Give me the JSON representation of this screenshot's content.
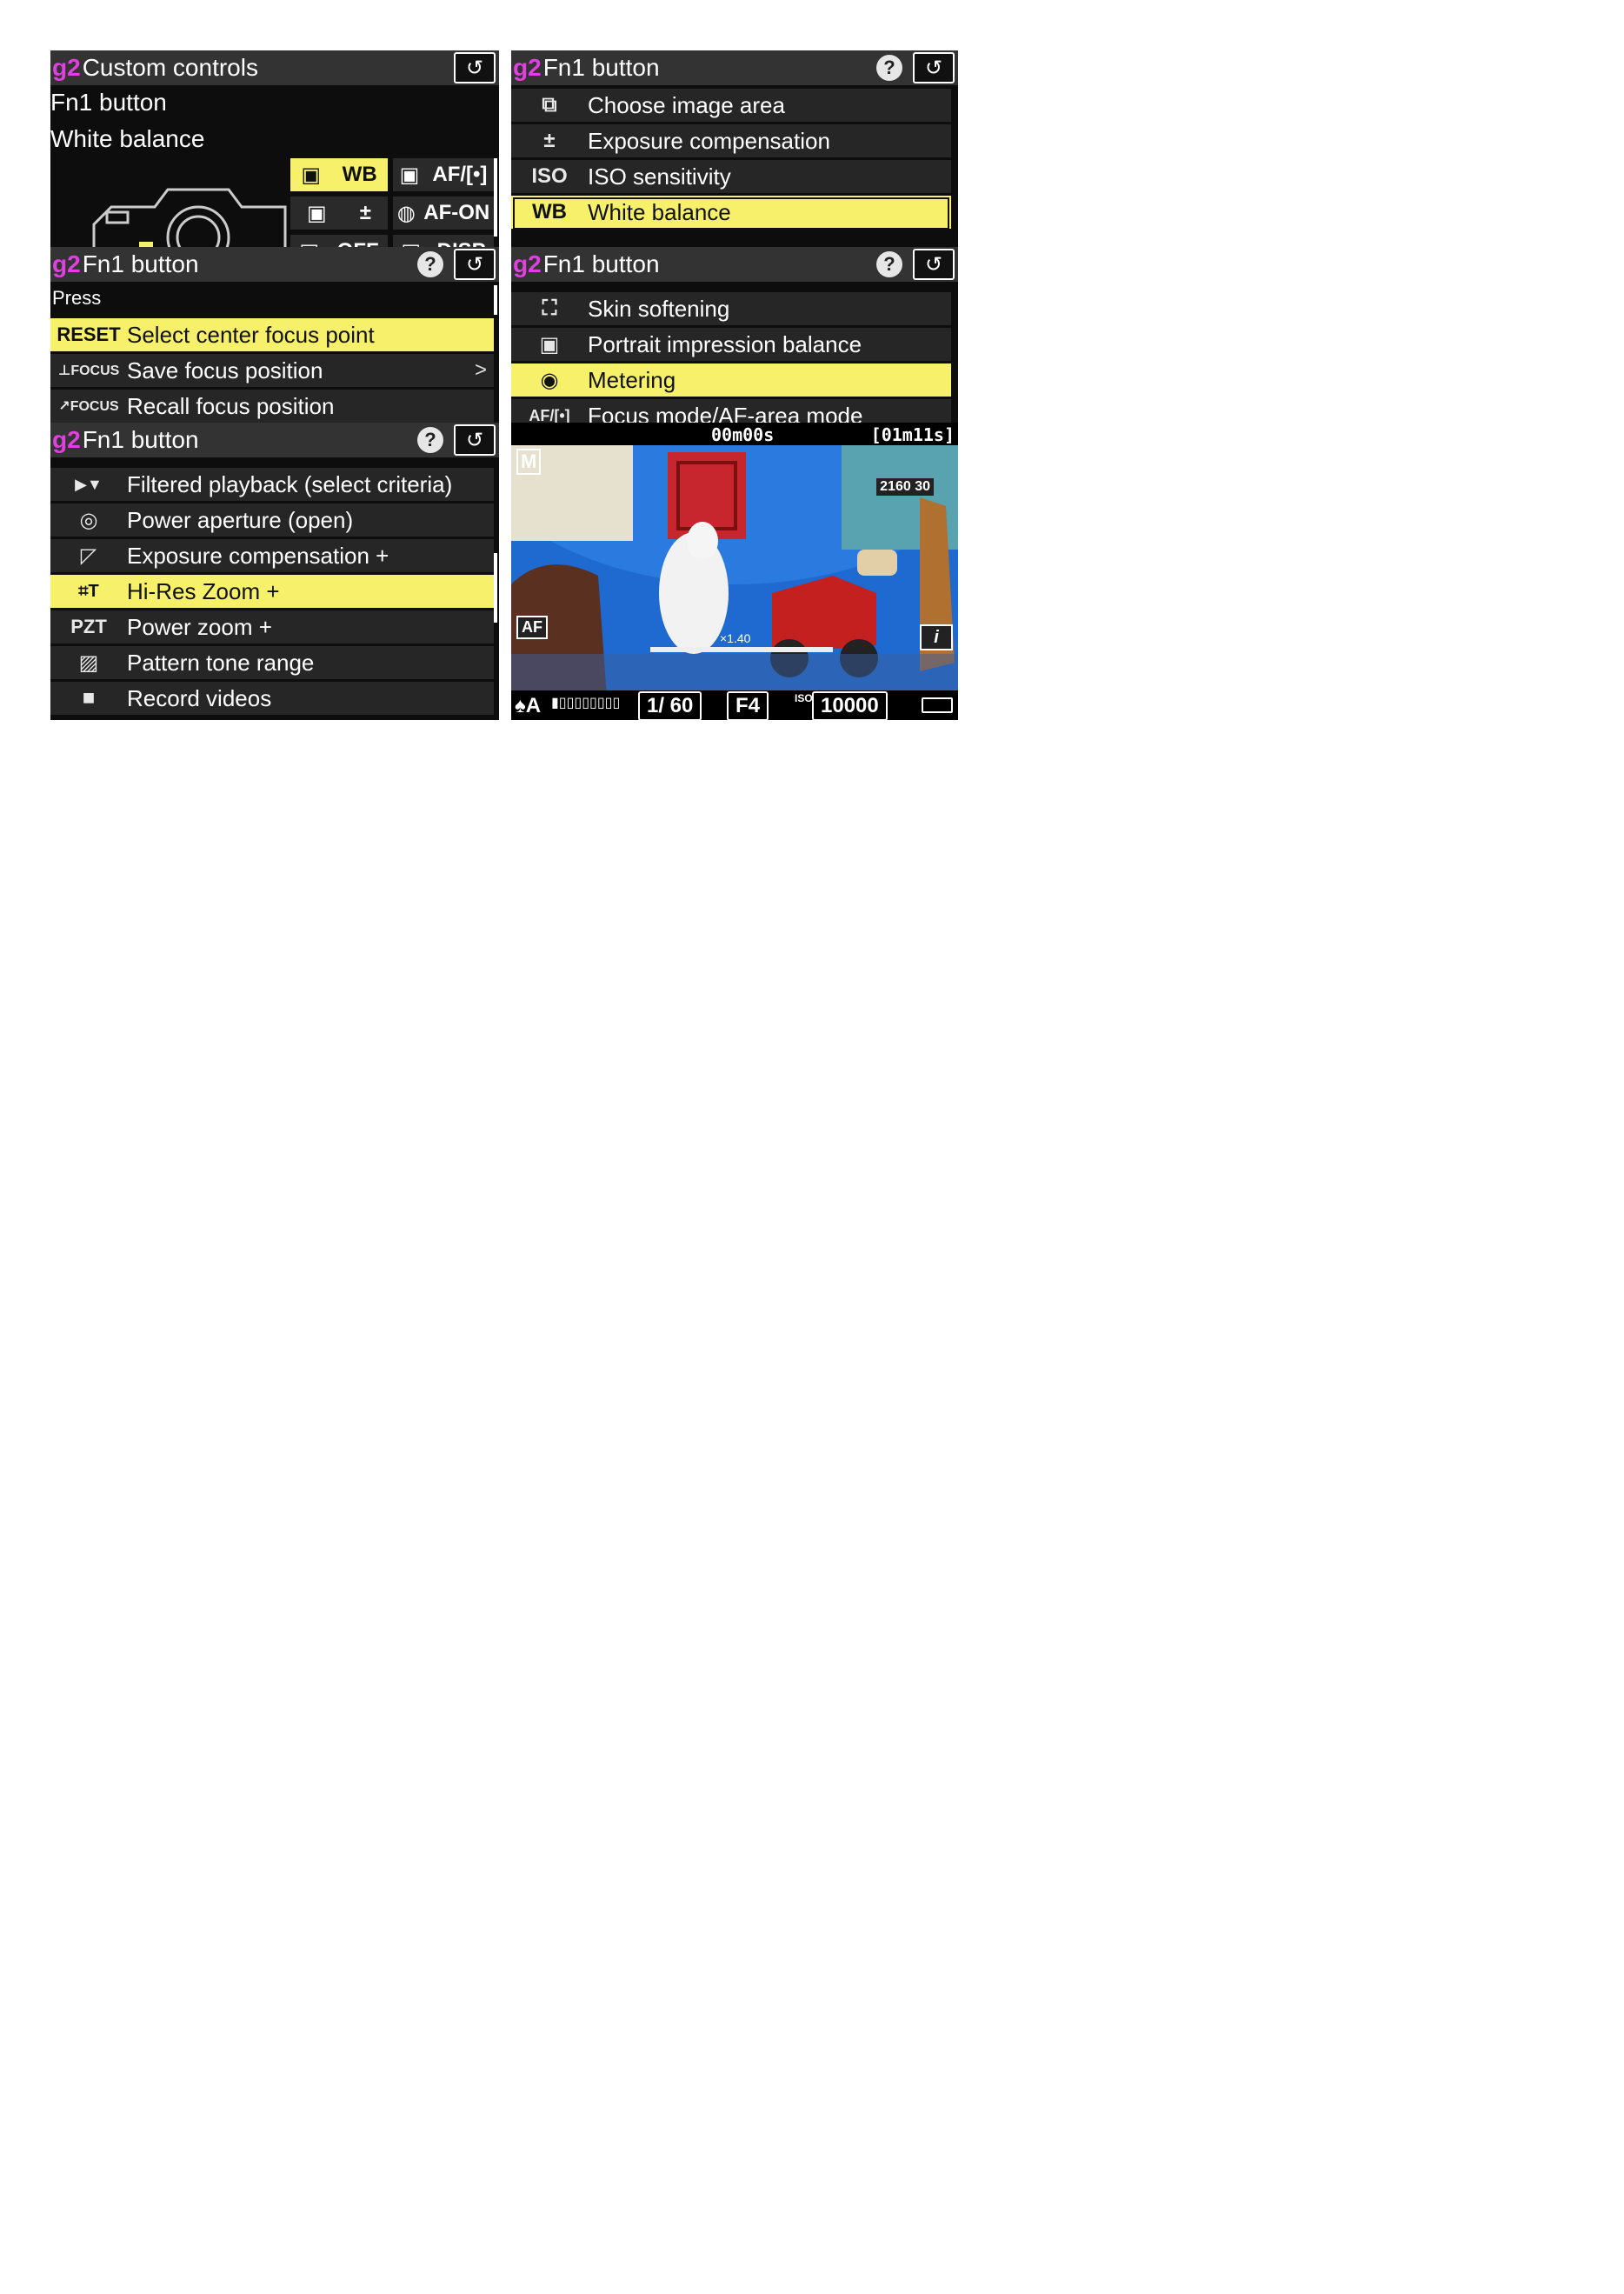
{
  "panel1": {
    "section": "g2",
    "title": "Custom controls",
    "line1": "Fn1 button",
    "line2": "White balance",
    "grid": [
      "WB",
      "AF/[•]",
      "AF-ON",
      "OFF",
      "DISP"
    ]
  },
  "panel2": {
    "section": "g2",
    "title": "Fn1 button",
    "help": "?",
    "items": [
      {
        "icon": "⧉",
        "label": "Choose image area"
      },
      {
        "icon": "±",
        "label": "Exposure compensation"
      },
      {
        "icon": "ISO",
        "label": "ISO sensitivity"
      },
      {
        "icon": "WB",
        "label": "White balance"
      }
    ]
  },
  "panel3": {
    "section": "g2",
    "title": "Fn1 button",
    "help": "?",
    "subheader": "Press",
    "items": [
      {
        "icon": "RESET",
        "label": "Select center focus point"
      },
      {
        "icon": "⊥FOCUS",
        "label": "Save focus position",
        "chevron": ">"
      },
      {
        "icon": "↗FOCUS",
        "label": "Recall focus position"
      }
    ]
  },
  "panel4": {
    "section": "g2",
    "title": "Fn1 button",
    "help": "?",
    "items": [
      {
        "icon": "⛶",
        "label": "Skin softening"
      },
      {
        "icon": "▣",
        "label": "Portrait impression balance"
      },
      {
        "icon": "◉",
        "label": "Metering"
      },
      {
        "icon": "AF/[•]",
        "label": "Focus mode/AF-area mode"
      }
    ]
  },
  "panel5": {
    "section": "g2",
    "title": "Fn1 button",
    "help": "?",
    "items": [
      {
        "icon": "▶▼",
        "label": "Filtered playback (select criteria)"
      },
      {
        "icon": "◎",
        "label": "Power aperture (open)"
      },
      {
        "icon": "◸",
        "label": "Exposure compensation +"
      },
      {
        "icon": "⌗T",
        "label": "Hi-Res Zoom +"
      },
      {
        "icon": "PZT",
        "label": "Power zoom +"
      },
      {
        "icon": "▨",
        "label": "Pattern tone range"
      },
      {
        "icon": "■",
        "label": "Record videos"
      }
    ]
  },
  "liveview": {
    "timer": "00m00s",
    "remaining": "[01m11s]",
    "mode": "M",
    "resolution": "2160 30",
    "af": "AF",
    "zoom": "×1.40",
    "shutter": "1/ 60",
    "aperture": "F4",
    "iso_label": "ISO",
    "iso": "10000",
    "info": "i"
  },
  "colors": {
    "highlight": "#f7f06a",
    "section": "#e040e0",
    "header": "#333333"
  }
}
